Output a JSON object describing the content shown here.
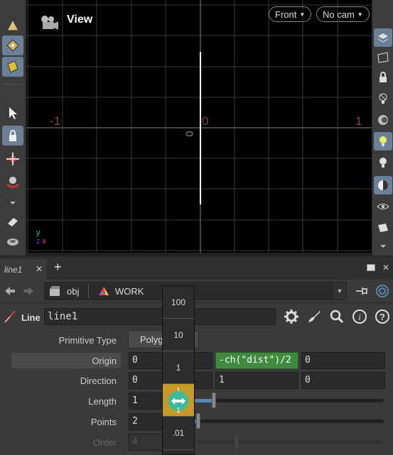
{
  "viewport": {
    "title": "View",
    "view_dropdown": "Front",
    "camera_dropdown": "No cam",
    "axis_labels": {
      "left": "-1",
      "center": "0",
      "right": "1",
      "vertical": "0"
    },
    "gizmo": {
      "y": "y",
      "z": "z",
      "x": "x"
    }
  },
  "tabbar": {
    "tab_label": "line1",
    "add_label": "+"
  },
  "pathbar": {
    "obj": "obj",
    "network": "WORK"
  },
  "node": {
    "type_label": "Line",
    "name": "line1"
  },
  "params": {
    "primitive_type": {
      "label": "Primitive Type",
      "value": "Polygon"
    },
    "origin": {
      "label": "Origin",
      "x": "0",
      "y": "-ch(\"dist\")/2",
      "z": "0"
    },
    "direction": {
      "label": "Direction",
      "x": "0",
      "y": "1",
      "z": "0"
    },
    "length": {
      "label": "Length",
      "value": "1",
      "slider_fraction": 0.1
    },
    "points": {
      "label": "Points",
      "value": "2",
      "slider_fraction": 0.02
    },
    "order": {
      "label": "Order",
      "value": "4"
    }
  },
  "ladder": {
    "steps": [
      "100",
      "10",
      "1",
      "",
      ".01"
    ],
    "selected_index": 3,
    "selected_top_value": "1",
    "selected_bottom_value": "1"
  },
  "colors": {
    "accent": "#6b7f96",
    "expression": "#3f8a3f",
    "ladder_selected": "#c59a2a",
    "slider_fill": "#5a86b0"
  }
}
